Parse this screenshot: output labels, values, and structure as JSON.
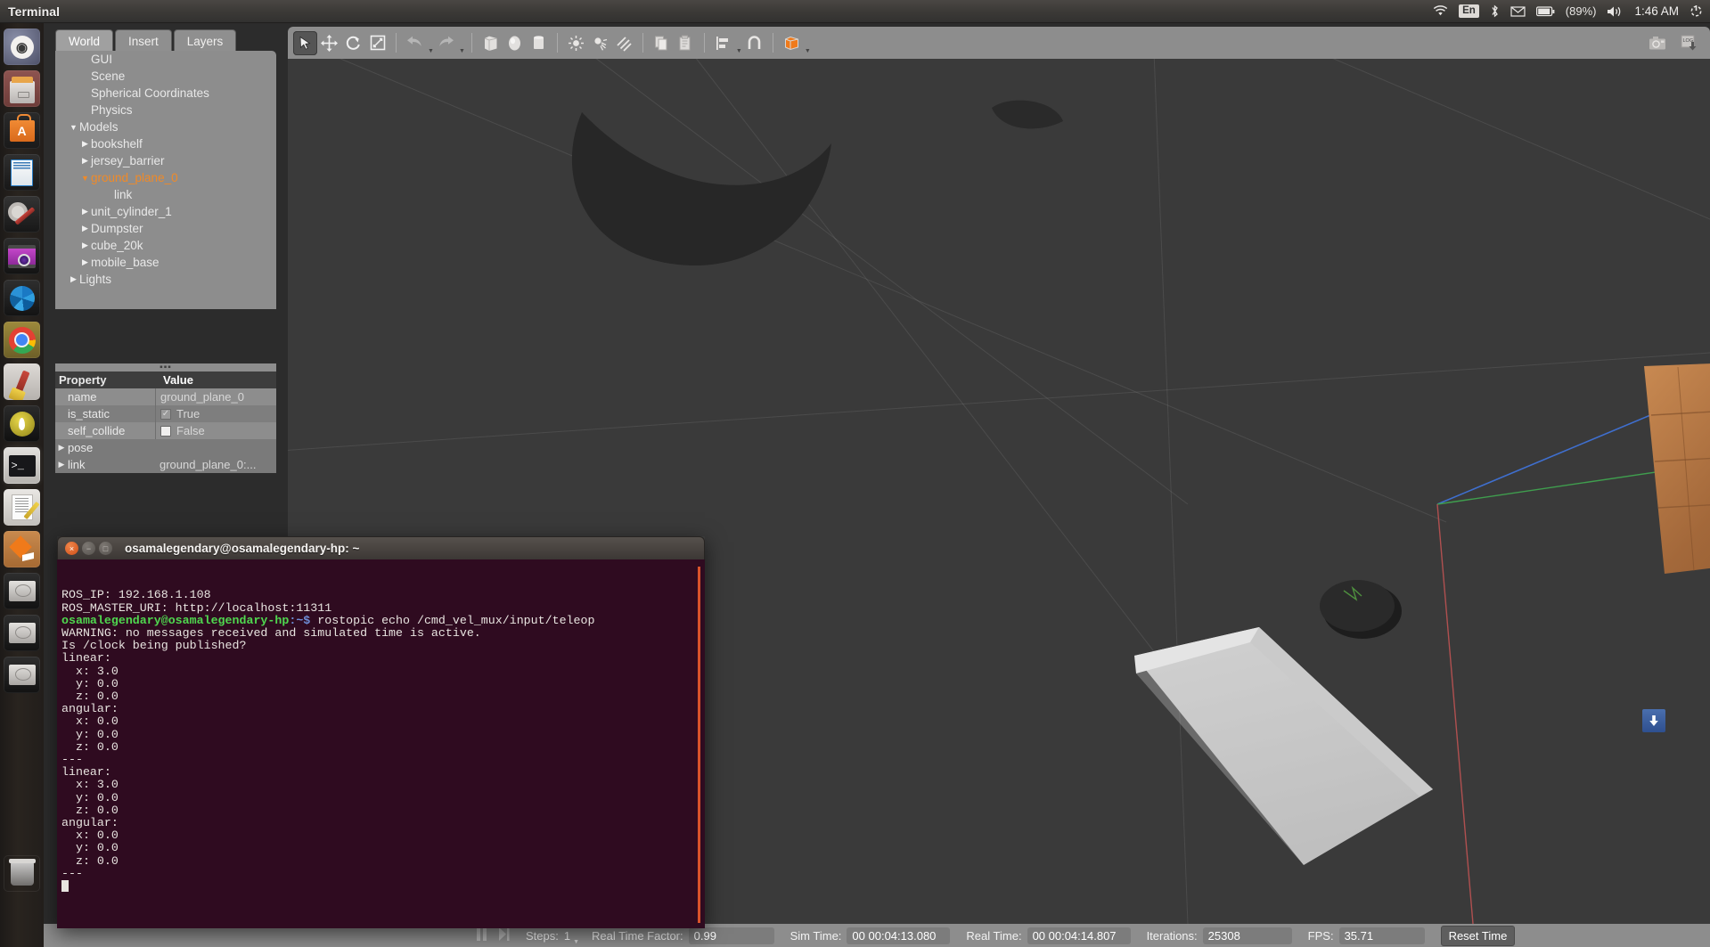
{
  "top_panel": {
    "title": "Terminal",
    "indicators": {
      "wifi": "wifi-icon",
      "keyboard": "En",
      "bluetooth": "bluetooth-icon",
      "mail": "mail-icon",
      "battery_icon": "battery-icon",
      "battery_level": "(89%)",
      "volume": "volume-icon",
      "clock": "1:46 AM",
      "session": "power-gear-icon"
    }
  },
  "launcher": {
    "items": [
      {
        "name": "ubuntu-dash",
        "label": "Ubuntu Dash"
      },
      {
        "name": "files",
        "label": "Files"
      },
      {
        "name": "software-center",
        "label": "Ubuntu Software Center"
      },
      {
        "name": "libreoffice-writer",
        "label": "LibreOffice Writer"
      },
      {
        "name": "system-tools",
        "label": "System Tools"
      },
      {
        "name": "video-player",
        "label": "Video Player"
      },
      {
        "name": "shotwell",
        "label": "Shotwell Photo Manager"
      },
      {
        "name": "google-chrome",
        "label": "Google Chrome"
      },
      {
        "name": "cleaner",
        "label": "Cleaner"
      },
      {
        "name": "gmount-iso",
        "label": "GMount ISO"
      },
      {
        "name": "terminal",
        "label": "Terminal"
      },
      {
        "name": "text-editor",
        "label": "Text Editor"
      },
      {
        "name": "gazebo",
        "label": "Gazebo"
      },
      {
        "name": "disk-1",
        "label": "Disk Volume"
      },
      {
        "name": "disk-2",
        "label": "Disk Volume"
      },
      {
        "name": "disk-3",
        "label": "Disk Volume"
      },
      {
        "name": "trash",
        "label": "Trash"
      }
    ]
  },
  "gazebo": {
    "tabs": [
      {
        "label": "World",
        "selected": true
      },
      {
        "label": "Insert",
        "selected": false
      },
      {
        "label": "Layers",
        "selected": false
      }
    ],
    "tree": [
      {
        "label": "GUI",
        "indent": 1,
        "arrow": "none",
        "selected": false
      },
      {
        "label": "Scene",
        "indent": 1,
        "arrow": "none",
        "selected": false
      },
      {
        "label": "Spherical Coordinates",
        "indent": 1,
        "arrow": "none",
        "selected": false
      },
      {
        "label": "Physics",
        "indent": 1,
        "arrow": "none",
        "selected": false
      },
      {
        "label": "Models",
        "indent": 0,
        "arrow": "expanded",
        "selected": false
      },
      {
        "label": "bookshelf",
        "indent": 1,
        "arrow": "collapsed",
        "selected": false
      },
      {
        "label": "jersey_barrier",
        "indent": 1,
        "arrow": "collapsed",
        "selected": false
      },
      {
        "label": "ground_plane_0",
        "indent": 1,
        "arrow": "expanded",
        "selected": true
      },
      {
        "label": "link",
        "indent": 3,
        "arrow": "none",
        "selected": false
      },
      {
        "label": "unit_cylinder_1",
        "indent": 1,
        "arrow": "collapsed",
        "selected": false
      },
      {
        "label": "Dumpster",
        "indent": 1,
        "arrow": "collapsed",
        "selected": false
      },
      {
        "label": "cube_20k",
        "indent": 1,
        "arrow": "collapsed",
        "selected": false
      },
      {
        "label": "mobile_base",
        "indent": 1,
        "arrow": "collapsed",
        "selected": false
      },
      {
        "label": "Lights",
        "indent": 0,
        "arrow": "collapsed",
        "selected": false
      }
    ],
    "properties": {
      "headers": {
        "property": "Property",
        "value": "Value"
      },
      "rows": [
        {
          "property": "name",
          "value": "ground_plane_0",
          "kind": "text",
          "arrow": "none"
        },
        {
          "property": "is_static",
          "value": "True",
          "kind": "checkbox",
          "checked": true,
          "arrow": "none"
        },
        {
          "property": "self_collide",
          "value": "False",
          "kind": "checkbox",
          "checked": false,
          "arrow": "none"
        },
        {
          "property": "pose",
          "value": "",
          "kind": "group",
          "arrow": "collapsed"
        },
        {
          "property": "link",
          "value": "ground_plane_0:...",
          "kind": "text",
          "arrow": "collapsed"
        }
      ]
    },
    "toolbar": {
      "items": [
        {
          "name": "select-mode-icon",
          "state": "active"
        },
        {
          "name": "translate-mode-icon",
          "state": "normal"
        },
        {
          "name": "rotate-mode-icon",
          "state": "normal"
        },
        {
          "name": "scale-mode-icon",
          "state": "normal"
        },
        {
          "name": "undo-icon",
          "state": "disabled"
        },
        {
          "name": "undo-history-caret",
          "state": "disabled"
        },
        {
          "name": "redo-icon",
          "state": "disabled"
        },
        {
          "name": "redo-history-caret",
          "state": "disabled"
        },
        {
          "name": "insert-box-icon",
          "state": "normal"
        },
        {
          "name": "insert-sphere-icon",
          "state": "normal"
        },
        {
          "name": "insert-cylinder-icon",
          "state": "normal"
        },
        {
          "name": "point-light-icon",
          "state": "normal"
        },
        {
          "name": "spot-light-icon",
          "state": "normal"
        },
        {
          "name": "directional-light-icon",
          "state": "normal"
        },
        {
          "name": "copy-icon",
          "state": "normal"
        },
        {
          "name": "paste-icon",
          "state": "normal"
        },
        {
          "name": "align-icon",
          "state": "normal"
        },
        {
          "name": "snap-icon",
          "state": "normal"
        },
        {
          "name": "view-color-icon",
          "state": "normal"
        }
      ],
      "right_items": [
        {
          "name": "screenshot-icon"
        },
        {
          "name": "log-download-icon",
          "label": "LOG"
        }
      ]
    },
    "statusbar": {
      "play_icon": "pause-icon",
      "step_icon": "step-icon",
      "steps_label": "Steps:",
      "steps_value": "1",
      "rtf_label": "Real Time Factor:",
      "rtf_value": "0.99",
      "sim_time_label": "Sim Time:",
      "sim_time_value": "00 00:04:13.080",
      "real_time_label": "Real Time:",
      "real_time_value": "00 00:04:14.807",
      "iterations_label": "Iterations:",
      "iterations_value": "25308",
      "fps_label": "FPS:",
      "fps_value": "35.71",
      "reset_button": "Reset Time"
    },
    "viewport": {
      "download_badge": "download-arrow-icon"
    }
  },
  "terminal": {
    "title": "osamalegendary@osamalegendary-hp: ~",
    "window_buttons": {
      "close": "×",
      "minimize": "−",
      "maximize": "□"
    },
    "lines": [
      {
        "text": "ROS_IP: 192.168.1.108",
        "style": "plain"
      },
      {
        "text": "ROS_MASTER_URI: http://localhost:11311",
        "style": "plain"
      },
      {
        "prompt_user": "osamalegendary@osamalegendary-hp",
        "prompt_path": ":~$ ",
        "text": "rostopic echo /cmd_vel_mux/input/teleop",
        "style": "prompt"
      },
      {
        "text": "WARNING: no messages received and simulated time is active.",
        "style": "plain"
      },
      {
        "text": "Is /clock being published?",
        "style": "plain"
      },
      {
        "text": "linear:",
        "style": "plain"
      },
      {
        "text": "  x: 3.0",
        "style": "plain"
      },
      {
        "text": "  y: 0.0",
        "style": "plain"
      },
      {
        "text": "  z: 0.0",
        "style": "plain"
      },
      {
        "text": "angular:",
        "style": "plain"
      },
      {
        "text": "  x: 0.0",
        "style": "plain"
      },
      {
        "text": "  y: 0.0",
        "style": "plain"
      },
      {
        "text": "  z: 0.0",
        "style": "plain"
      },
      {
        "text": "---",
        "style": "plain"
      },
      {
        "text": "linear:",
        "style": "plain"
      },
      {
        "text": "  x: 3.0",
        "style": "plain"
      },
      {
        "text": "  y: 0.0",
        "style": "plain"
      },
      {
        "text": "  z: 0.0",
        "style": "plain"
      },
      {
        "text": "angular:",
        "style": "plain"
      },
      {
        "text": "  x: 0.0",
        "style": "plain"
      },
      {
        "text": "  y: 0.0",
        "style": "plain"
      },
      {
        "text": "  z: 0.0",
        "style": "plain"
      },
      {
        "text": "---",
        "style": "plain"
      },
      {
        "text": "",
        "style": "cursor"
      }
    ]
  },
  "colors": {
    "accent_orange": "#f08a28",
    "terminal_bg": "#2f0b20",
    "panel_bg": "#8d8d8d",
    "viewport_bg": "#3a3a3a",
    "prompt_green": "#4fd84f",
    "prompt_blue": "#6f8fd8"
  }
}
